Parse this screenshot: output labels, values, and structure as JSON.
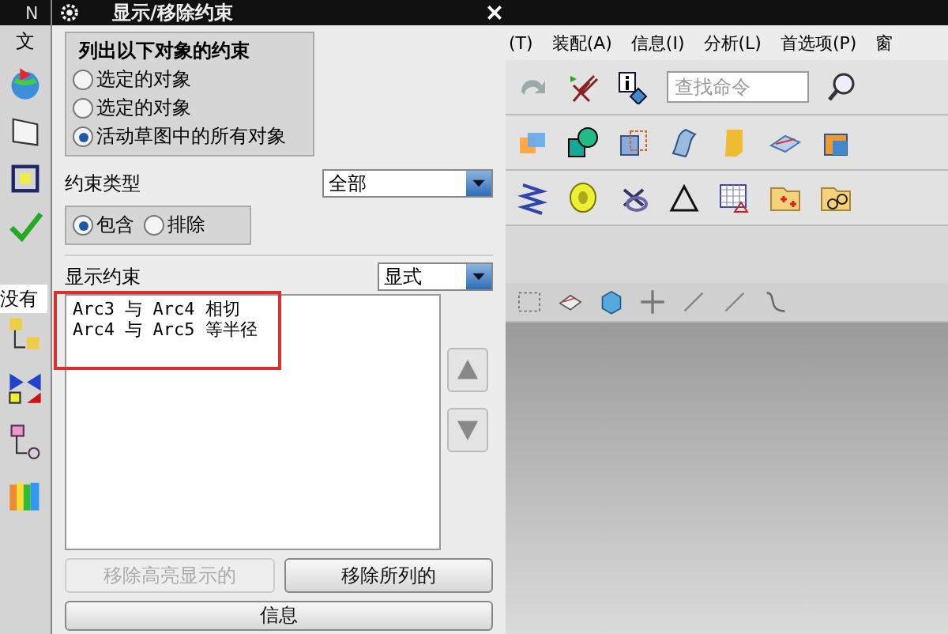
{
  "app": {
    "corner_text": "N",
    "menu": [
      "文",
      "(T)",
      "装配(A)",
      "信息(I)",
      "分析(L)",
      "首选项(P)",
      "窗"
    ],
    "search": {
      "placeholder": "查找命令"
    },
    "side_field": "没有"
  },
  "dialog": {
    "title": "显示/移除约束",
    "group_title": "列出以下对象的约束",
    "object_options": [
      {
        "label": "选定的对象",
        "selected": false
      },
      {
        "label": "选定的对象",
        "selected": false
      },
      {
        "label": "活动草图中的所有对象",
        "selected": true
      }
    ],
    "constraint_type_label": "约束类型",
    "constraint_type_value": "全部",
    "mode_options": [
      {
        "label": "包含",
        "selected": true
      },
      {
        "label": "排除",
        "selected": false
      }
    ],
    "display_label": "显示约束",
    "display_value": "显式",
    "constraints": [
      "Arc3 与 Arc4 相切",
      "Arc4 与 Arc5 等半径"
    ],
    "buttons": [
      {
        "label": "移除高亮显示的",
        "disabled": true
      },
      {
        "label": "移除所列的",
        "disabled": false
      }
    ],
    "info_button": "信息"
  }
}
